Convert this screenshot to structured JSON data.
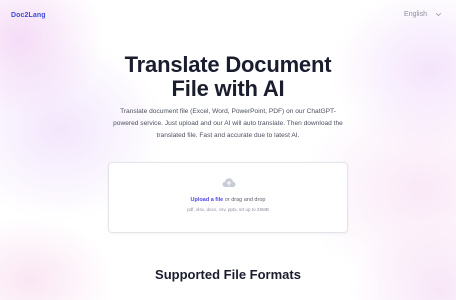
{
  "header": {
    "logo_text": "Doc2Lang",
    "language_label": "English",
    "language_icon": "chevron-down-icon"
  },
  "hero": {
    "title_line1": "Translate Document",
    "title_line2": "File with AI",
    "description": "Translate document file (Excel, Word, PowerPoint, PDF) on our ChatGPT-powered service. Just upload and our AI will auto translate. Then download the translated file. Fast and accurate due to latest AI."
  },
  "upload": {
    "icon": "cloud-upload-icon",
    "link_text": "Upload a file",
    "drag_text": " or drag and drop",
    "hint": "pdf, xlsx, docx, csv, pptx, srt up to 25MB"
  },
  "formats": {
    "title": "Supported File Formats"
  },
  "colors": {
    "accent": "#4f46e5",
    "logo": "#3d4fd6",
    "heading": "#1a1d2e"
  }
}
